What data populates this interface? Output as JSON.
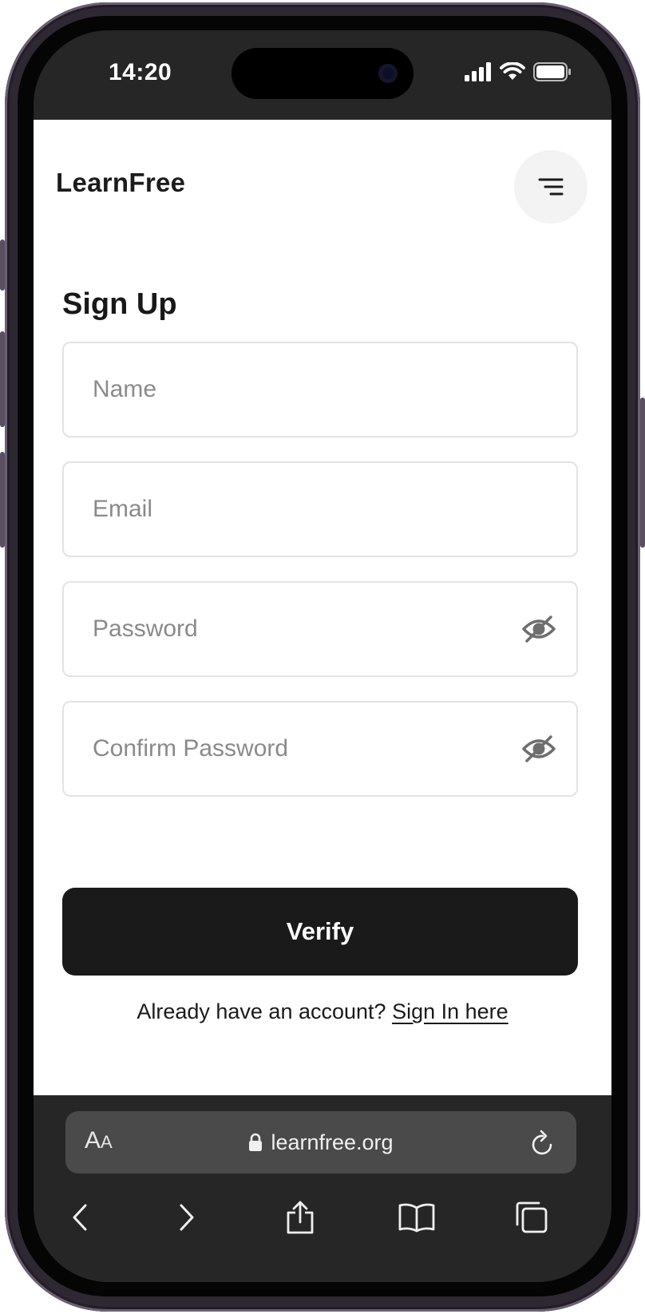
{
  "status_bar": {
    "time": "14:20",
    "icons": [
      "signal-icon",
      "wifi-icon",
      "battery-icon"
    ]
  },
  "header": {
    "logo": "LearnFree",
    "menu_icon": "menu-icon"
  },
  "form": {
    "title": "Sign Up",
    "name_placeholder": "Name",
    "email_placeholder": "Email",
    "password_placeholder": "Password",
    "confirm_password_placeholder": "Confirm Password",
    "visibility_icon": "eye-off-icon",
    "verify_label": "Verify",
    "signin_prompt": "Already have an account?",
    "signin_link": "Sign In here"
  },
  "browser": {
    "text_size_label_large": "A",
    "text_size_label_small": "A",
    "url": "learnfree.org",
    "lock_icon": "lock-icon",
    "reload_icon": "reload-icon",
    "toolbar": [
      "back-icon",
      "forward-icon",
      "share-icon",
      "bookmarks-icon",
      "tabs-icon"
    ]
  },
  "colors": {
    "button_bg": "#1a1a1a",
    "chrome_bg": "#262626",
    "url_bar_bg": "#4a4a4a",
    "field_border": "#e3e3e3",
    "placeholder": "#8a8a8a"
  }
}
